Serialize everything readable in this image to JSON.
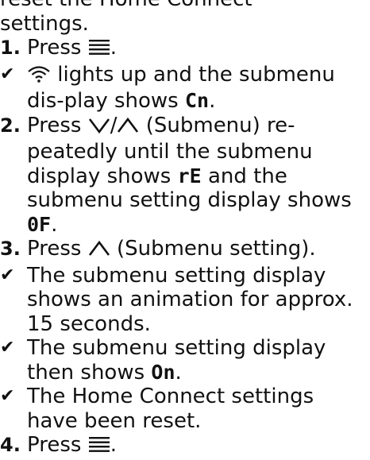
{
  "intro": {
    "text": "reset the Home Connect settings."
  },
  "icons": {
    "menu": "menu-lines-icon",
    "wifi": "wifi-icon",
    "down": "chevron-down-icon",
    "up": "chevron-up-icon",
    "check": "checkmark-icon"
  },
  "steps": [
    {
      "num": "1.",
      "before": "Press ",
      "after": "."
    },
    {
      "check": "✔",
      "before": " lights up and the submenu dis-play shows ",
      "code": "Cn",
      "after": "."
    },
    {
      "num": "2.",
      "before": "Press ",
      "mid": "/",
      "after": " (Submenu) re-peatedly until the submenu display shows ",
      "code1": "rE",
      "after2": " and the submenu setting display shows ",
      "code2": "0F",
      "after3": "."
    },
    {
      "num": "3.",
      "before": "Press ",
      "after": " (Submenu setting)."
    },
    {
      "check": "✔",
      "text": "The submenu setting display shows an animation for approx. 15 seconds."
    },
    {
      "check": "✔",
      "before": "The submenu setting display then shows ",
      "code": "On",
      "after": "."
    },
    {
      "check": "✔",
      "text": "The Home Connect settings have been reset."
    },
    {
      "num": "4.",
      "before": "Press ",
      "after": "."
    }
  ]
}
